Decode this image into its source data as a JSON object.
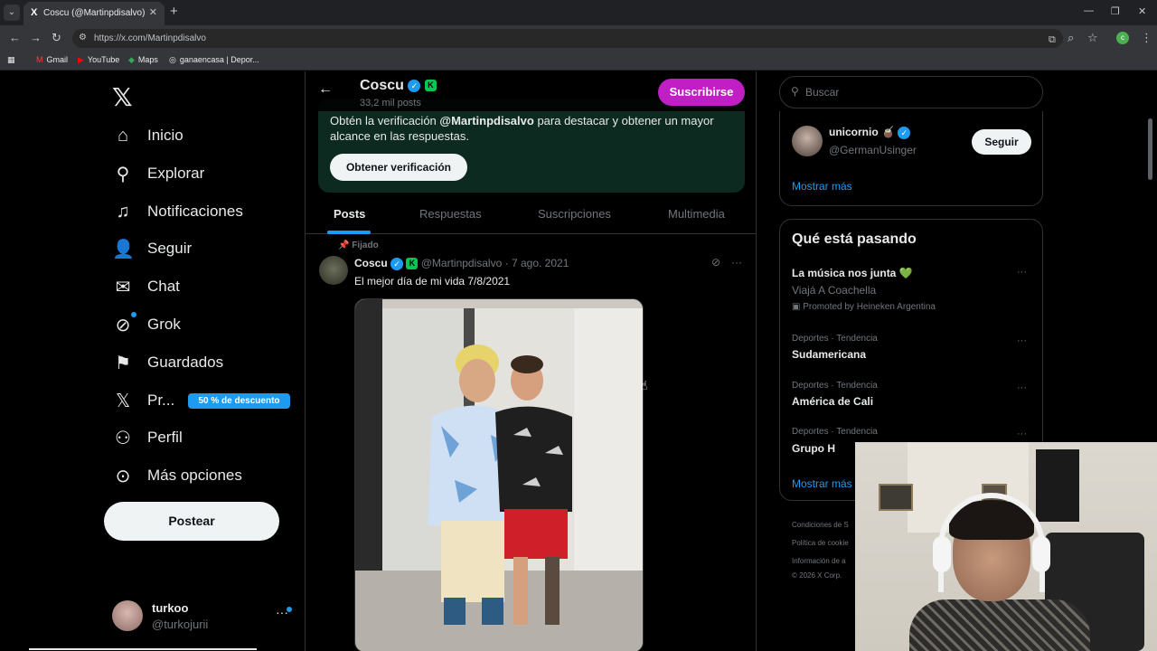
{
  "browser": {
    "tab_title": "Coscu (@Martinpdisalvo) / X",
    "tab_favicon": "X",
    "url": "https://x.com/Martinpdisalvo",
    "bookmarks": [
      "Gmail",
      "YouTube",
      "Maps",
      "ganaencasa | Depor..."
    ],
    "profile_initial": "c"
  },
  "nav": {
    "items": [
      {
        "label": "Inicio",
        "icon": "home-icon"
      },
      {
        "label": "Explorar",
        "icon": "search-icon"
      },
      {
        "label": "Notificaciones",
        "icon": "bell-icon"
      },
      {
        "label": "Seguir",
        "icon": "follow-icon"
      },
      {
        "label": "Chat",
        "icon": "mail-icon"
      },
      {
        "label": "Grok",
        "icon": "grok-icon"
      },
      {
        "label": "Guardados",
        "icon": "bookmark-icon"
      },
      {
        "label": "Pr...",
        "icon": "x-premium-icon"
      },
      {
        "label": "Perfil",
        "icon": "person-icon"
      },
      {
        "label": "Más opciones",
        "icon": "more-icon"
      }
    ],
    "premium_badge": "50 % de descuento",
    "post_button": "Postear",
    "account": {
      "name": "turkoo",
      "handle": "@turkojurii",
      "more": "···"
    }
  },
  "profile": {
    "name": "Coscu",
    "post_count": "33,2 mil posts",
    "subscribe_button": "Suscribirse",
    "promo": {
      "text_before": "Obtén la verificación ",
      "handle": "@Martinpdisalvo",
      "text_after": " para destacar y obtener un mayor alcance en las respuestas.",
      "button": "Obtener verificación"
    },
    "tabs": [
      "Posts",
      "Respuestas",
      "Suscripciones",
      "Multimedia"
    ],
    "active_tab": "Posts"
  },
  "tweet": {
    "pinned_label": "Fijado",
    "name": "Coscu",
    "handle": "@Martinpdisalvo",
    "separator": "·",
    "date": "7 ago. 2021",
    "text": "El mejor día de mi vida 7/8/2021"
  },
  "sidebar": {
    "search_placeholder": "Buscar",
    "who_to_follow": {
      "name": "unicornio 🧉",
      "handle": "@GermanUsinger",
      "follow_button": "Seguir",
      "show_more": "Mostrar más"
    },
    "trends_title": "Qué está pasando",
    "trends": [
      {
        "name": "La música nos junta 💚",
        "sub": "Viajá A Coachella",
        "promoted": "Promoted by Heineken Argentina"
      },
      {
        "meta": "Deportes · Tendencia",
        "name": "Sudamericana"
      },
      {
        "meta": "Deportes · Tendencia",
        "name": "América de Cali"
      },
      {
        "meta": "Deportes · Tendencia",
        "name": "Grupo H"
      }
    ],
    "show_more": "Mostrar más",
    "footer": [
      "Condiciones de S",
      "Política de cookie",
      "Información de a",
      "© 2026 X Corp."
    ]
  }
}
